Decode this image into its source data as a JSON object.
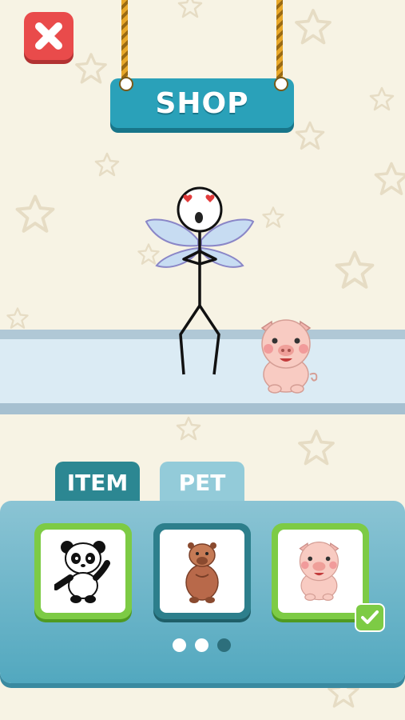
{
  "header": {
    "title": "SHOP"
  },
  "tabs": [
    {
      "label": "ITEM",
      "active": false
    },
    {
      "label": "PET",
      "active": true
    }
  ],
  "pets": [
    {
      "name": "panda",
      "icon": "panda-icon",
      "selected": false
    },
    {
      "name": "capybara",
      "icon": "capybara-icon",
      "selected": true
    },
    {
      "name": "pig",
      "icon": "pig-icon",
      "equipped": true
    }
  ],
  "pagination": {
    "total": 3,
    "current": 3
  },
  "colors": {
    "background": "#f7f3e4",
    "sign": "#2aa1b9",
    "close": "#e94b4b",
    "slot_green": "#7dcb45",
    "slot_selected": "#2d7f8c",
    "panel": "#52a8bf"
  }
}
